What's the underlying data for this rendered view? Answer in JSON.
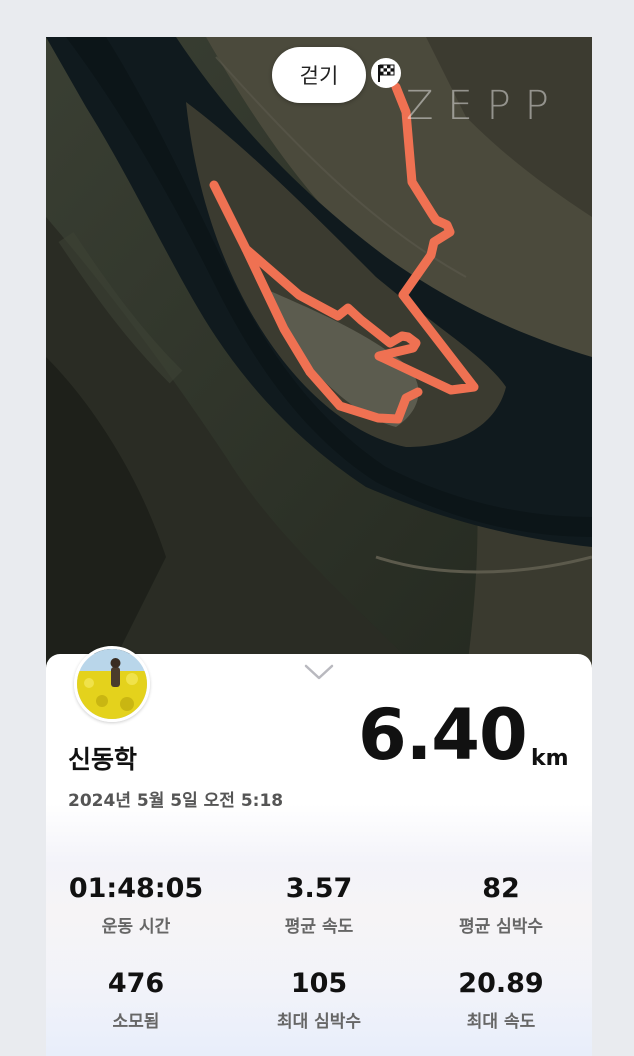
{
  "map": {
    "activity_type": "걷기",
    "watermark": "ZEPP",
    "finish_icon": "checkered-flag-icon",
    "route_color": "#ef7152"
  },
  "summary": {
    "user_name": "신동학",
    "date": "2024년 5월 5일 오전 5:18",
    "distance_value": "6.40",
    "distance_unit": "km"
  },
  "stats": [
    {
      "value": "01:48:05",
      "label": "운동 시간"
    },
    {
      "value": "3.57",
      "label": "평균 속도"
    },
    {
      "value": "82",
      "label": "평균 심박수"
    },
    {
      "value": "476",
      "label": "소모됨"
    },
    {
      "value": "105",
      "label": "최대 심박수"
    },
    {
      "value": "20.89",
      "label": "최대 속도"
    }
  ]
}
